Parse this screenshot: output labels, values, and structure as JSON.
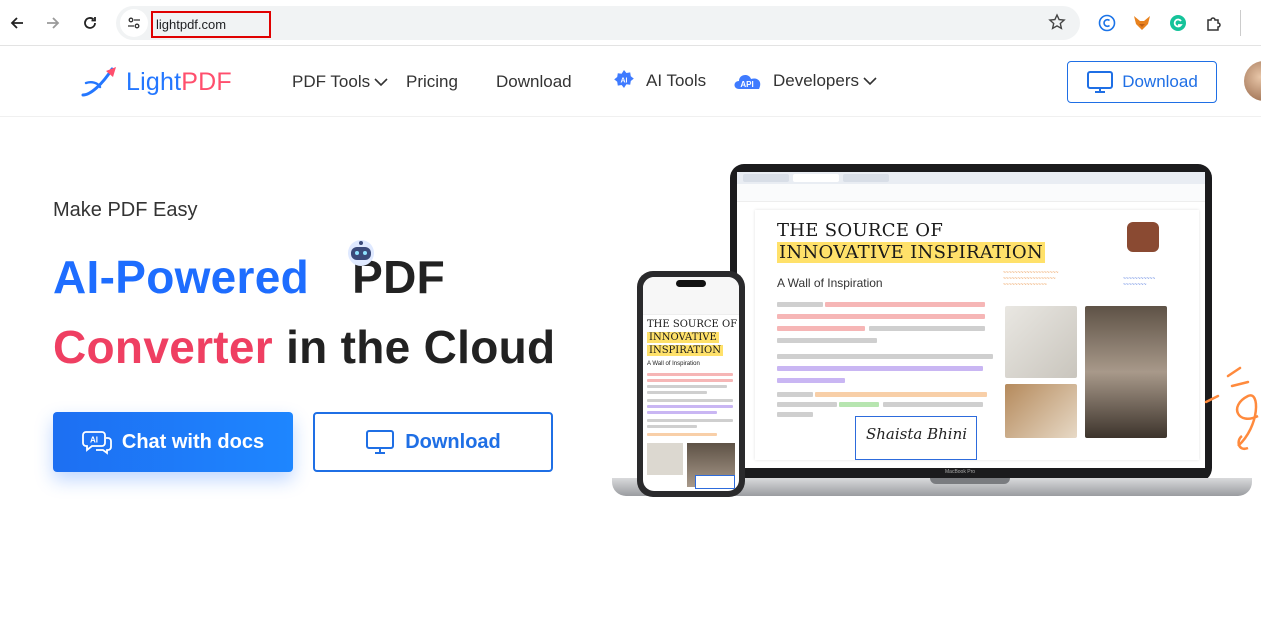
{
  "browser": {
    "url": "lightpdf.com"
  },
  "header": {
    "logo_light": "Light",
    "logo_pdf": "PDF",
    "nav": {
      "pdf_tools": "PDF Tools",
      "pricing": "Pricing",
      "download": "Download",
      "ai_tools": "AI Tools",
      "developers": "Developers"
    },
    "ai_badge": "AI",
    "api_badge": "API",
    "download_button": "Download"
  },
  "hero": {
    "tagline": "Make PDF Easy",
    "title_part1": "AI-Powered",
    "title_part2": "PDF",
    "title_part3": "Converter",
    "title_part4": "in the Cloud",
    "chat_button": "Chat with docs",
    "chat_icon_text": "AI",
    "download_button": "Download"
  },
  "mockup": {
    "doc_title_line1": "THE SOURCE OF",
    "doc_title_line2": "INNOVATIVE INSPIRATION",
    "doc_subtitle": "A Wall of Inspiration",
    "signature": "Shaista Bhini",
    "laptop_label": "MacBook Pro",
    "phone_title_line1": "THE SOURCE OF",
    "phone_title_line2": "INNOVATIVE",
    "phone_title_line3": "INSPIRATION",
    "phone_subtitle": "A Wall of Inspiration"
  },
  "colors": {
    "brand_blue": "#1e6dff",
    "brand_pink": "#ef3f62",
    "highlight_yellow": "#ffe16a"
  }
}
